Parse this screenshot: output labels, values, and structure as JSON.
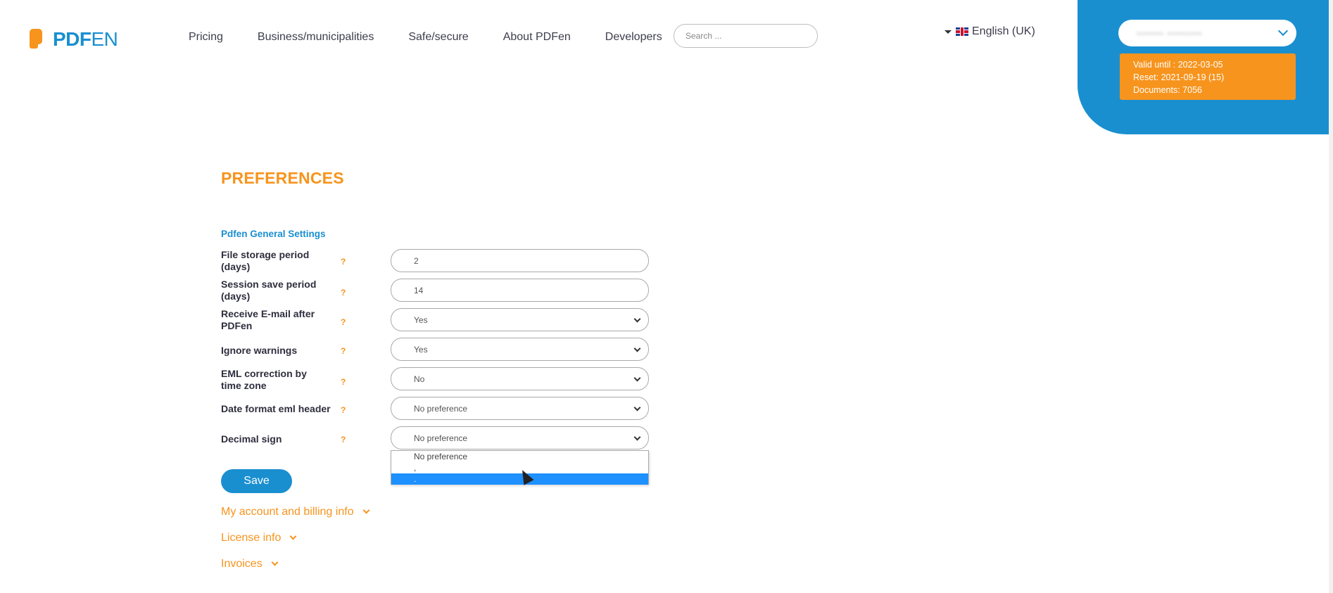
{
  "header": {
    "logo": {
      "pdf": "PDF",
      "en": "EN"
    },
    "nav": [
      "Pricing",
      "Business/municipalities",
      "Safe/secure",
      "About PDFen",
      "Developers"
    ],
    "search_placeholder": "Search ...",
    "language": "English (UK)"
  },
  "account": {
    "name": "••••••• •••••••••",
    "valid_until": "Valid until : 2022-03-05",
    "reset": "Reset: 2021-09-19 (15)",
    "documents": "Documents: 7056"
  },
  "page": {
    "title": "PREFERENCES",
    "section_title": "Pdfen General Settings"
  },
  "settings": [
    {
      "label": "File storage period (days)",
      "value": "2",
      "help": "?"
    },
    {
      "label": "Session save period (days)",
      "value": "14",
      "help": "?"
    },
    {
      "label": "Receive E-mail after PDFen",
      "value": "Yes",
      "help": "?"
    },
    {
      "label": "Ignore warnings",
      "value": "Yes",
      "help": "?"
    },
    {
      "label": "EML correction by time zone",
      "value": "No",
      "help": "?"
    },
    {
      "label": "Date format eml header",
      "value": "No preference",
      "help": "?"
    },
    {
      "label": "Decimal sign",
      "value": "No preference",
      "help": "?"
    }
  ],
  "dropdown_options": [
    "No preference",
    ",",
    "."
  ],
  "save_label": "Save",
  "links": [
    "My account and billing info",
    "License info",
    "Invoices"
  ],
  "colors": {
    "brand_blue": "#1a8fd0",
    "brand_orange": "#f7941d",
    "selection_blue": "#1e90ff"
  }
}
